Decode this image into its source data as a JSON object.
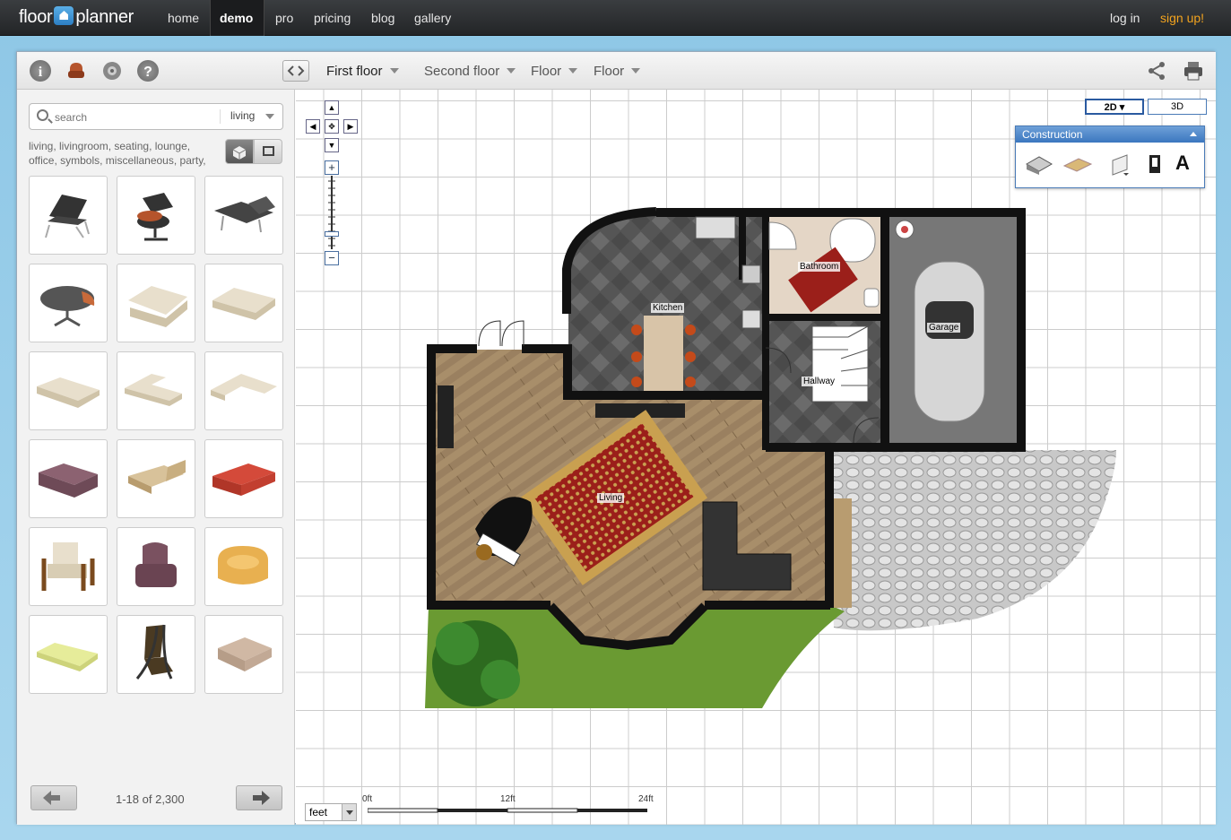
{
  "nav": {
    "logo_left": "floor",
    "logo_right": "planner",
    "links": [
      "home",
      "demo",
      "pro",
      "pricing",
      "blog",
      "gallery"
    ],
    "login": "log in",
    "signup": "sign up!"
  },
  "toolbar": {
    "floors": [
      "First floor",
      "Second floor",
      "Floor",
      "Floor"
    ]
  },
  "sidebar": {
    "search_placeholder": "search",
    "category": "living",
    "tags": "living, livingroom, seating, lounge, office, symbols, miscellaneous, party,",
    "items": [
      "barcelona-chair",
      "eames-lounge-chair",
      "reclining-chair",
      "eames-ottoman",
      "beige-armchair",
      "beige-loveseat",
      "beige-sofa",
      "beige-corner-sofa",
      "beige-l-sofa",
      "purple-sofa",
      "chaise-lounge",
      "red-sofa",
      "wooden-armchair",
      "purple-armchair",
      "yellow-tub-chair",
      "green-chaise",
      "poang-chair",
      "sectional-sofa"
    ],
    "pager": "1-18 of 2,300"
  },
  "canvas": {
    "view_2d": "2D",
    "view_3d": "3D",
    "panel_title": "Construction",
    "rooms": [
      "Kitchen",
      "Bathroom",
      "Garage",
      "Hallway",
      "Living"
    ],
    "unit": "feet",
    "scale": [
      "0ft",
      "12ft",
      "24ft"
    ]
  }
}
